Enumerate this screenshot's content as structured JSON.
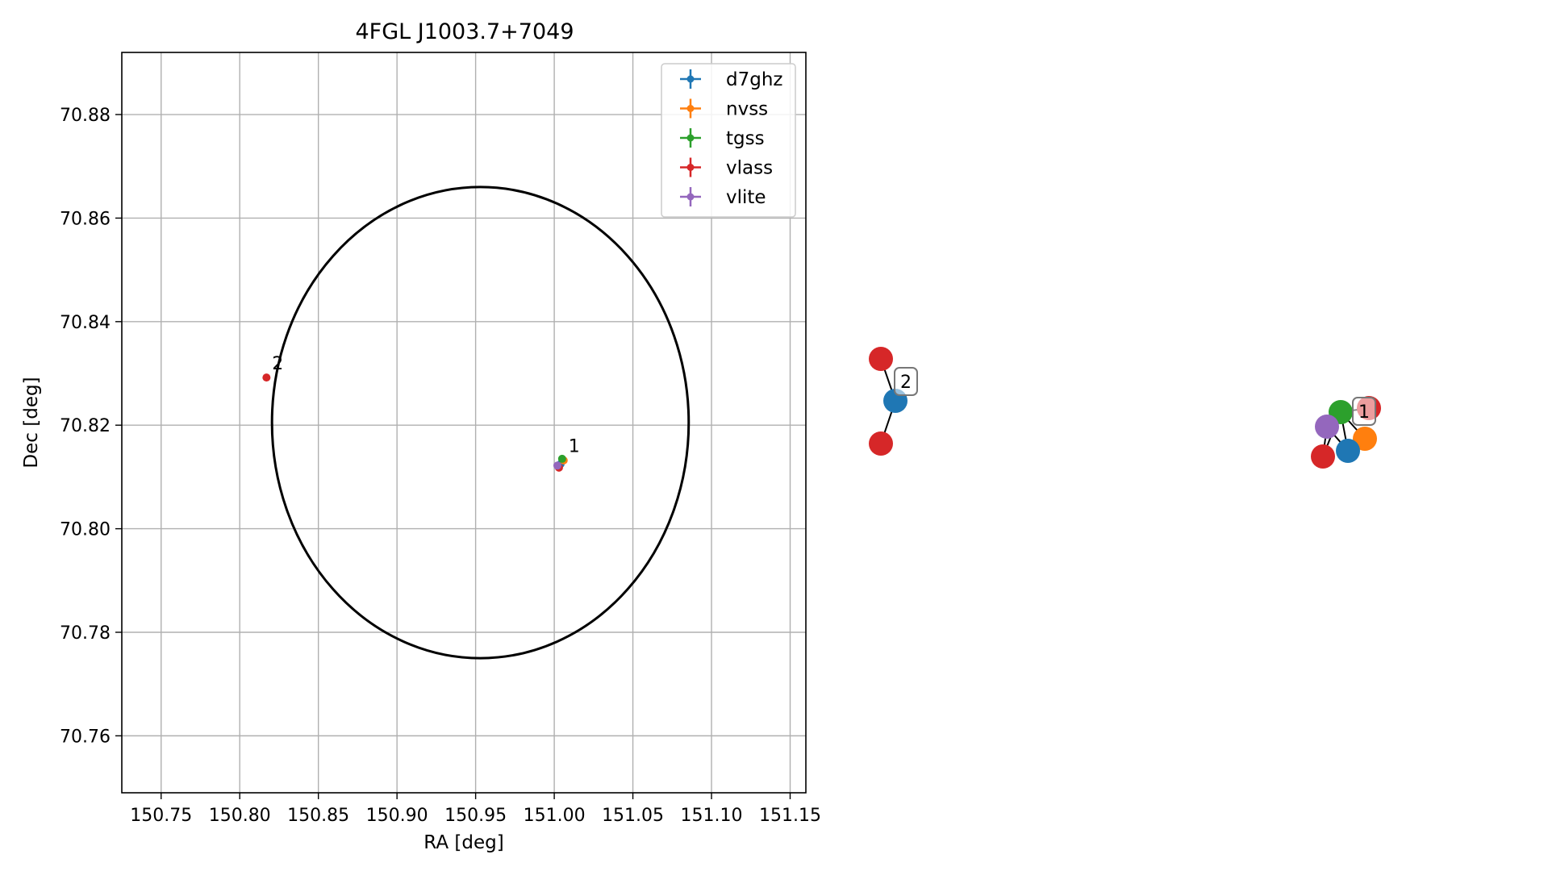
{
  "chart_data": [
    {
      "type": "scatter",
      "title": "4FGL J1003.7+7049",
      "xlabel": "RA [deg]",
      "ylabel": "Dec [deg]",
      "xlim": [
        150.725,
        151.16
      ],
      "ylim": [
        70.749,
        70.892
      ],
      "xticks": [
        150.75,
        150.8,
        150.85,
        150.9,
        150.95,
        151.0,
        151.05,
        151.1,
        151.15
      ],
      "xtick_labels": [
        "150.75",
        "150.80",
        "150.85",
        "150.90",
        "150.95",
        "151.00",
        "151.05",
        "151.10",
        "151.15"
      ],
      "yticks": [
        70.76,
        70.78,
        70.8,
        70.82,
        70.84,
        70.86,
        70.88
      ],
      "ytick_labels": [
        "70.76",
        "70.78",
        "70.80",
        "70.82",
        "70.84",
        "70.86",
        "70.88"
      ],
      "grid": true,
      "legend_position": "top-right",
      "series": [
        {
          "name": "d7ghz",
          "color": "#1f77b4",
          "points": [
            {
              "x": 151.004,
              "y": 70.8125
            }
          ]
        },
        {
          "name": "nvss",
          "color": "#ff7f0e",
          "points": [
            {
              "x": 151.006,
              "y": 70.8132
            }
          ]
        },
        {
          "name": "tgss",
          "color": "#2ca02c",
          "points": [
            {
              "x": 151.005,
              "y": 70.8135
            }
          ]
        },
        {
          "name": "vlass",
          "color": "#d62728",
          "points": [
            {
              "x": 151.003,
              "y": 70.8118
            },
            {
              "x": 150.817,
              "y": 70.8292
            }
          ]
        },
        {
          "name": "vlite",
          "color": "#9467bd",
          "points": [
            {
              "x": 151.002,
              "y": 70.8122
            }
          ]
        }
      ],
      "uncertainty_ellipse": {
        "center": [
          150.953,
          70.8205
        ],
        "semi_axis_ra": 0.1325,
        "semi_axis_dec": 0.0455,
        "color": "#000000"
      },
      "annotations": [
        {
          "text": "1",
          "x": 151.007,
          "y": 70.8145
        },
        {
          "text": "2",
          "x": 150.8185,
          "y": 70.8305
        }
      ]
    },
    {
      "type": "diagram",
      "groups": [
        {
          "label": "2",
          "nodes": [
            "vlass",
            "d7ghz",
            "vlass"
          ]
        },
        {
          "label": "1",
          "nodes": [
            "vlass",
            "tgss",
            "vlite",
            "nvss",
            "vlass",
            "d7ghz"
          ]
        }
      ]
    }
  ]
}
